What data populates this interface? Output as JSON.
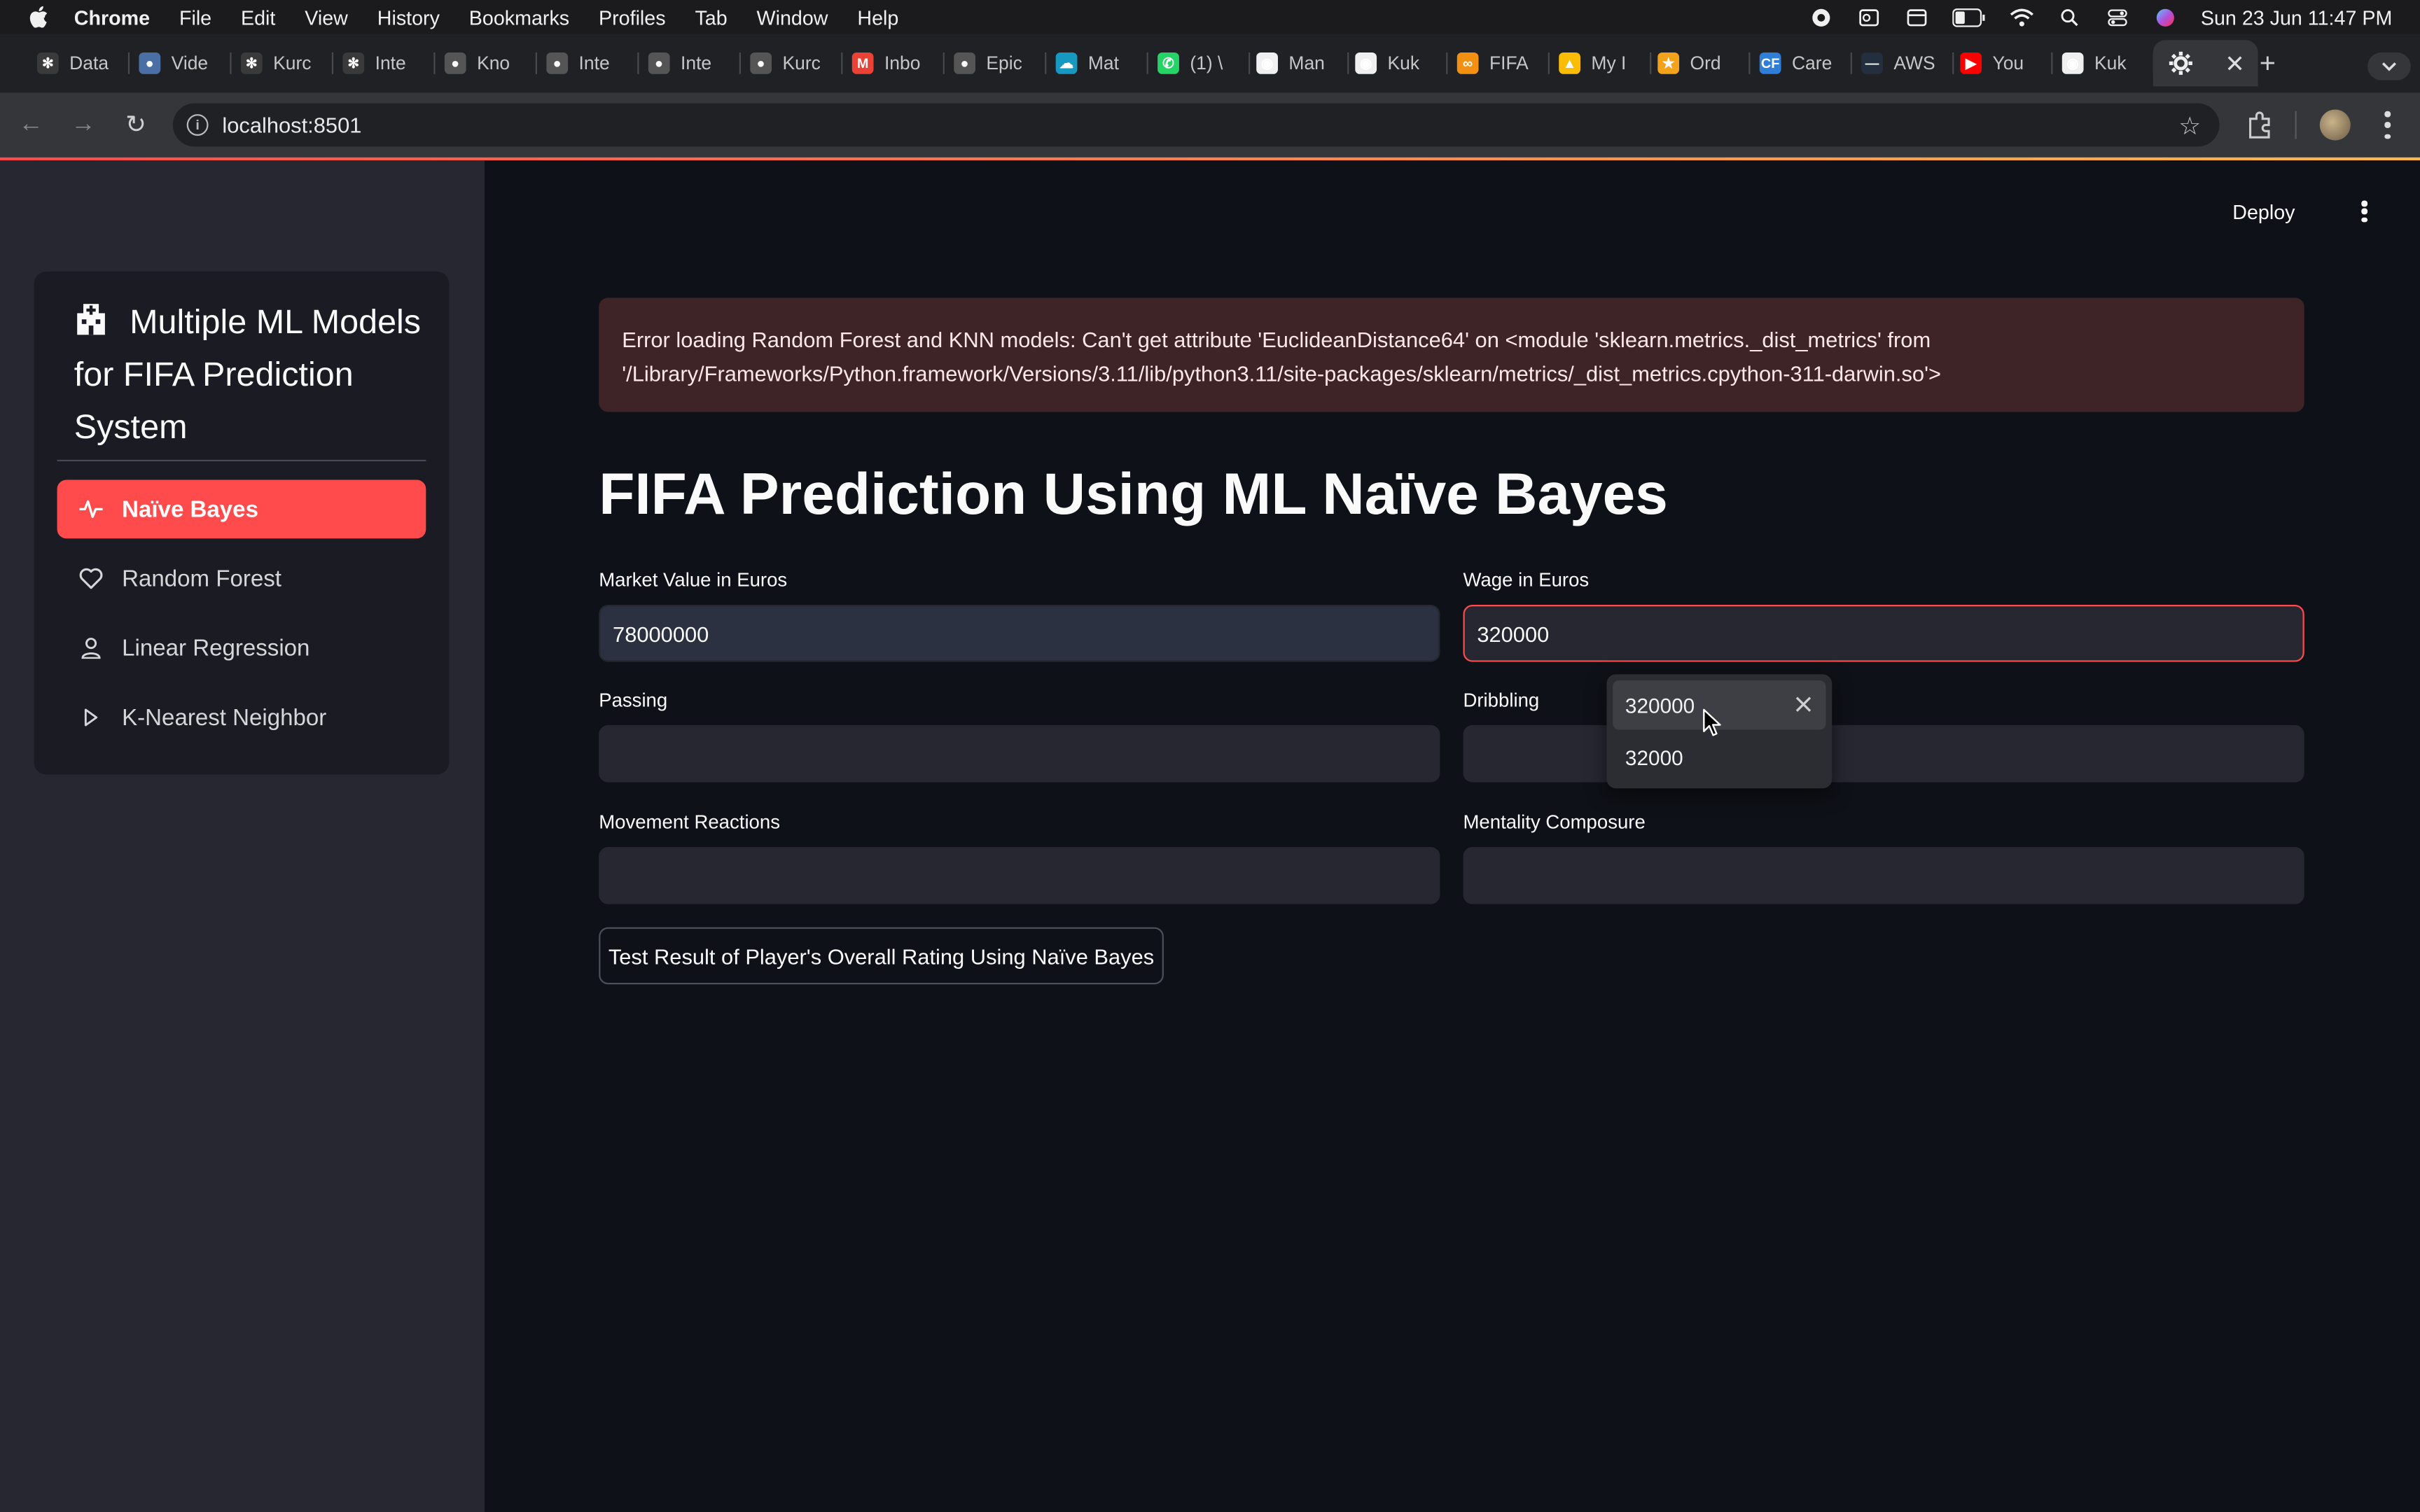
{
  "menubar": {
    "app": "Chrome",
    "items": [
      "File",
      "Edit",
      "View",
      "History",
      "Bookmarks",
      "Profiles",
      "Tab",
      "Window",
      "Help"
    ],
    "clock": "Sun 23 Jun  11:47 PM"
  },
  "tabs": [
    {
      "label": "Data",
      "icon": "openai-icon",
      "color": "#3a3a3a"
    },
    {
      "label": "Vide",
      "icon": "globe-icon",
      "color": "#4a6fa5"
    },
    {
      "label": "Kurc",
      "icon": "openai-icon",
      "color": "#3a3a3a"
    },
    {
      "label": "Inte",
      "icon": "openai-icon",
      "color": "#3a3a3a"
    },
    {
      "label": "Kno",
      "icon": "globe-icon",
      "color": "#555"
    },
    {
      "label": "Inte",
      "icon": "globe-icon",
      "color": "#555"
    },
    {
      "label": "Inte",
      "icon": "globe-icon",
      "color": "#555"
    },
    {
      "label": "Kurc",
      "icon": "globe-icon",
      "color": "#555"
    },
    {
      "label": "Inbo",
      "icon": "gmail-icon",
      "color": "#ea4335"
    },
    {
      "label": "Epic",
      "icon": "globe-icon",
      "color": "#555"
    },
    {
      "label": "Mat",
      "icon": "salesforce-icon",
      "color": "#1798c1"
    },
    {
      "label": "(1) \\",
      "icon": "whatsapp-icon",
      "color": "#25d366"
    },
    {
      "label": "Man",
      "icon": "github-icon",
      "color": "#f0f0f0"
    },
    {
      "label": "Kuk",
      "icon": "github-icon",
      "color": "#f0f0f0"
    },
    {
      "label": "FIFA",
      "icon": "infinity-icon",
      "color": "#f29111"
    },
    {
      "label": "My I",
      "icon": "drive-icon",
      "color": "#fbbc04"
    },
    {
      "label": "Ord",
      "icon": "star-badge-icon",
      "color": "#f4a21b"
    },
    {
      "label": "Care",
      "icon": "cf-icon",
      "color": "#2f7ed8"
    },
    {
      "label": "AWS",
      "icon": "aws-icon",
      "color": "#232f3e"
    },
    {
      "label": "You",
      "icon": "youtube-icon",
      "color": "#ff0000"
    },
    {
      "label": "Kuk",
      "icon": "github-icon",
      "color": "#f0f0f0"
    }
  ],
  "address_bar": {
    "url": "localhost:8501"
  },
  "header": {
    "deploy_label": "Deploy"
  },
  "sidebar": {
    "title": "Multiple ML Models for FIFA Prediction System",
    "items": [
      {
        "label": "Naïve Bayes",
        "icon": "activity-icon",
        "active": true
      },
      {
        "label": "Random Forest",
        "icon": "heart-icon",
        "active": false
      },
      {
        "label": "Linear Regression",
        "icon": "person-icon",
        "active": false
      },
      {
        "label": "K-Nearest Neighbor",
        "icon": "play-icon",
        "active": false
      }
    ]
  },
  "main": {
    "error_message": "Error loading Random Forest and KNN models: Can't get attribute 'EuclideanDistance64' on <module 'sklearn.metrics._dist_metrics' from '/Library/Frameworks/Python.framework/Versions/3.11/lib/python3.11/site-packages/sklearn/metrics/_dist_metrics.cpython-311-darwin.so'>",
    "title": "FIFA Prediction Using ML Naïve Bayes",
    "fields": [
      {
        "label": "Market Value in Euros",
        "value": "78000000"
      },
      {
        "label": "Wage in Euros",
        "value": "320000"
      },
      {
        "label": "Passing",
        "value": ""
      },
      {
        "label": "Dribbling",
        "value": ""
      },
      {
        "label": "Movement Reactions",
        "value": ""
      },
      {
        "label": "Mentality Composure",
        "value": ""
      }
    ],
    "submit_label": "Test Result of Player's Overall Rating Using Naïve Bayes",
    "autocomplete": [
      "320000",
      "32000"
    ]
  },
  "colors": {
    "accent": "#ff4b4b",
    "background": "#0e1117",
    "sidebar": "#262730",
    "error_bg": "#3e2327"
  }
}
